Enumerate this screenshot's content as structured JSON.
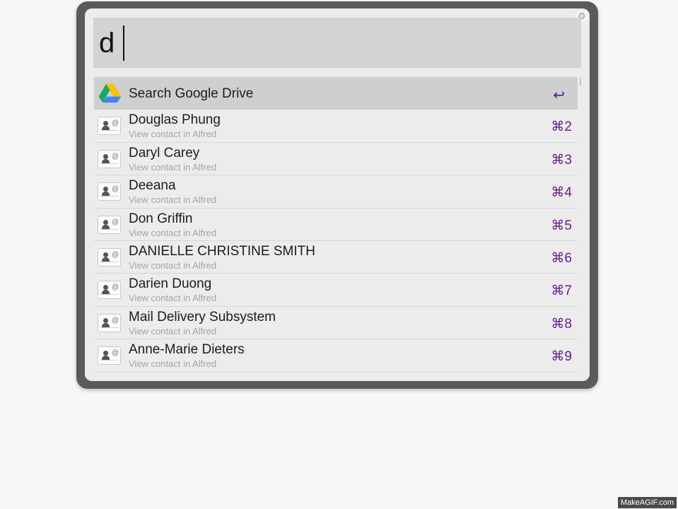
{
  "search": {
    "query": "d"
  },
  "selected_result": {
    "title": "Search Google Drive",
    "shortcut": "↩",
    "icon": "google-drive-icon"
  },
  "results": [
    {
      "title": "Douglas Phung",
      "subtitle": "View contact in Alfred",
      "shortcut": "⌘2",
      "icon": "contact-card-icon"
    },
    {
      "title": "Daryl Carey",
      "subtitle": "View contact in Alfred",
      "shortcut": "⌘3",
      "icon": "contact-card-icon"
    },
    {
      "title": "Deeana",
      "subtitle": "View contact in Alfred",
      "shortcut": "⌘4",
      "icon": "contact-card-icon"
    },
    {
      "title": "Don Griffin",
      "subtitle": "View contact in Alfred",
      "shortcut": "⌘5",
      "icon": "contact-card-icon"
    },
    {
      "title": "DANIELLE CHRISTINE SMITH",
      "subtitle": "View contact in Alfred",
      "shortcut": "⌘6",
      "icon": "contact-card-icon"
    },
    {
      "title": "Darien Duong",
      "subtitle": "View contact in Alfred",
      "shortcut": "⌘7",
      "icon": "contact-card-icon"
    },
    {
      "title": "Mail Delivery Subsystem",
      "subtitle": "View contact in Alfred",
      "shortcut": "⌘8",
      "icon": "contact-card-icon"
    },
    {
      "title": "Anne-Marie Dieters",
      "subtitle": "View contact in Alfred",
      "shortcut": "⌘9",
      "icon": "contact-card-icon"
    }
  ],
  "colors": {
    "shortcut": "#6a1b8a",
    "window_frame": "#5a5a5a",
    "selected_row": "#cfcfcf"
  },
  "watermark": "MakeAGIF.com"
}
